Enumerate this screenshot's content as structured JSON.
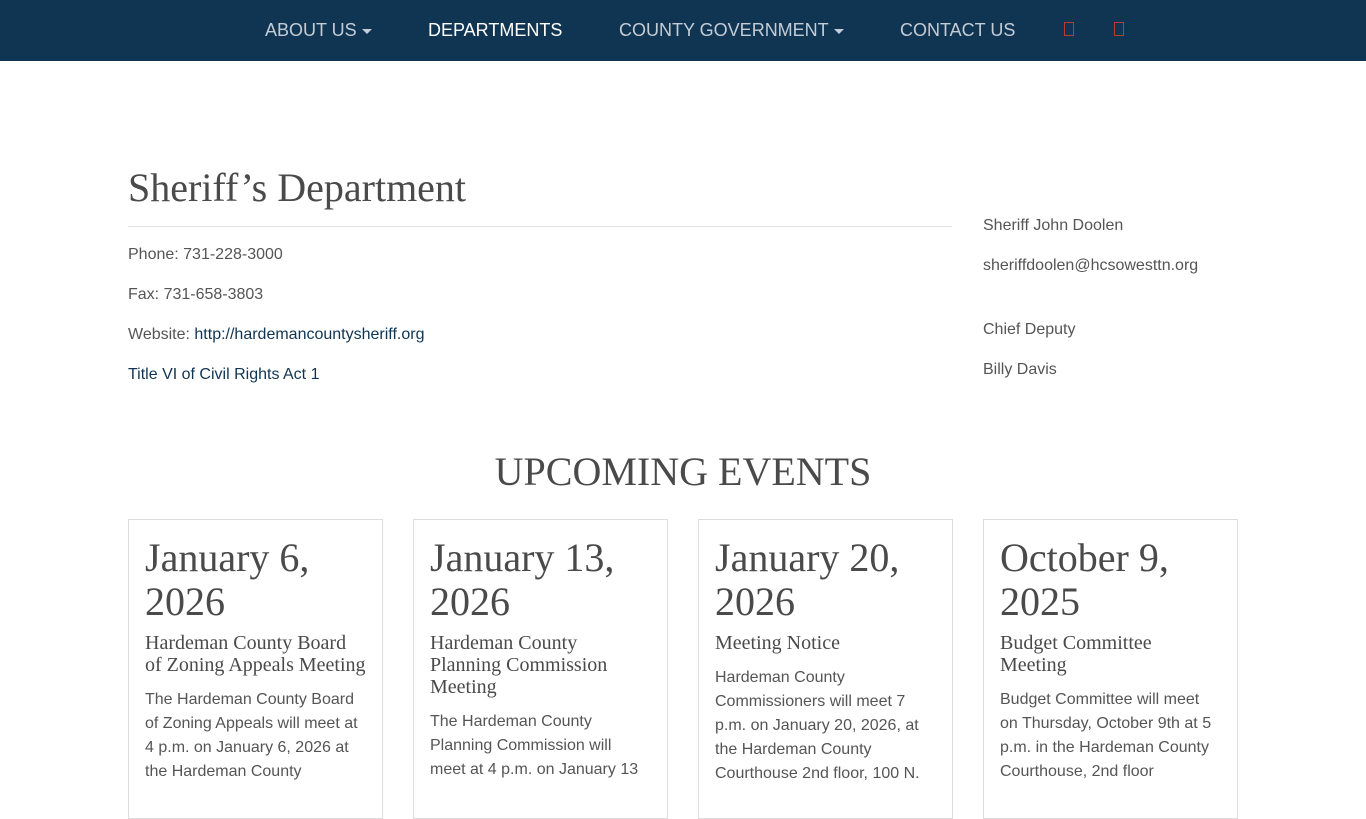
{
  "nav": {
    "items": [
      {
        "label": "ABOUT US",
        "dropdown": true
      },
      {
        "label": "DEPARTMENTS",
        "dropdown": false,
        "active": true
      },
      {
        "label": "COUNTY GOVERNMENT",
        "dropdown": true
      },
      {
        "label": "CONTACT US",
        "dropdown": false
      }
    ],
    "icons": [
      "unknown-glyph-icon",
      "unknown-glyph-icon"
    ],
    "background": "#103552",
    "icon_color": "#c0392b"
  },
  "page": {
    "title": "Sheriff’s Department",
    "phone": "Phone: 731-228-3000",
    "fax": "Fax: 731-658-3803",
    "website_label": "Website: ",
    "website_url": "http://hardemancountysheriff.org",
    "title_vi": "Title VI of Civil Rights Act 1",
    "link_color": "#103552"
  },
  "sidebar": {
    "lines": [
      "Sheriff John Doolen",
      "sheriffdoolen@hcsowesttn.org",
      "Chief Deputy",
      "Billy Davis"
    ]
  },
  "events": {
    "heading": "UPCOMING EVENTS",
    "items": [
      {
        "date": "January 6, 2026",
        "title": "Hardeman County Board of Zoning Appeals Meeting",
        "desc": "The Hardeman County Board of Zoning Appeals will meet at 4 p.m. on January 6, 2026 at the Hardeman County"
      },
      {
        "date": "January 13, 2026",
        "title": "Hardeman County Planning Commission Meeting",
        "desc": "The Hardeman County Planning Commission will meet at 4 p.m. on January 13"
      },
      {
        "date": "January 20, 2026",
        "title": "Meeting Notice",
        "desc": "Hardeman County Commissioners will meet 7 p.m. on January 20, 2026, at the Hardeman County Courthouse 2nd floor, 100 N."
      },
      {
        "date": "October 9, 2025",
        "title": "Budget Committee Meeting",
        "desc": "Budget Committee will meet on Thursday, October 9th at 5 p.m. in the Hardeman County Courthouse, 2nd floor"
      }
    ]
  }
}
